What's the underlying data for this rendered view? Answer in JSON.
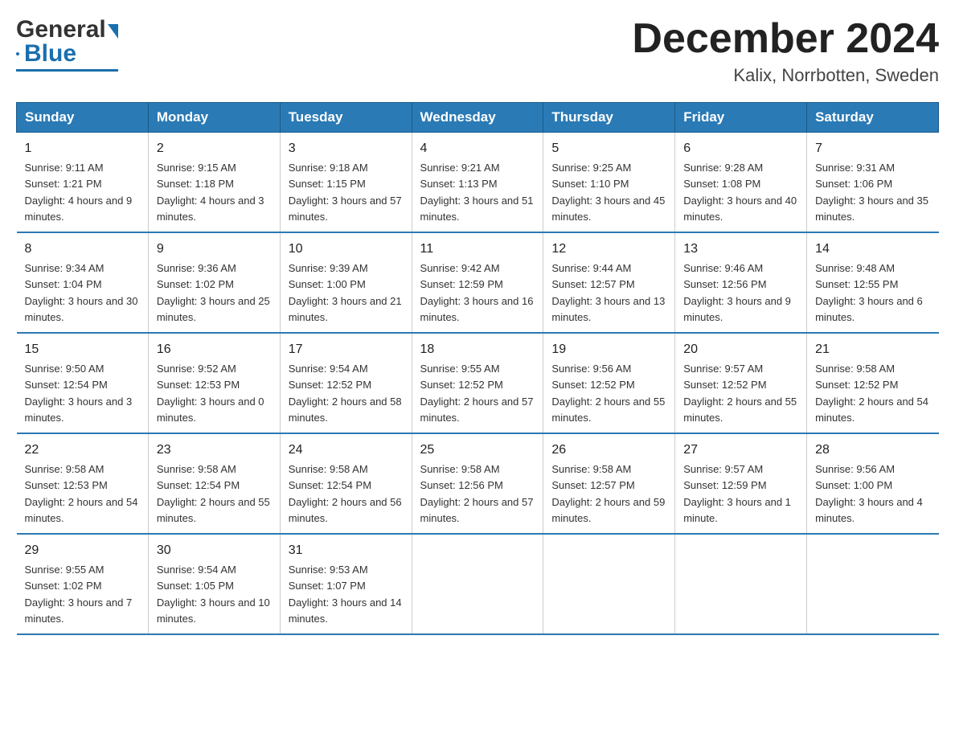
{
  "header": {
    "logo_general": "General",
    "logo_blue": "Blue",
    "month_title": "December 2024",
    "location": "Kalix, Norrbotten, Sweden"
  },
  "weekdays": [
    "Sunday",
    "Monday",
    "Tuesday",
    "Wednesday",
    "Thursday",
    "Friday",
    "Saturday"
  ],
  "weeks": [
    [
      {
        "day": "1",
        "sunrise": "Sunrise: 9:11 AM",
        "sunset": "Sunset: 1:21 PM",
        "daylight": "Daylight: 4 hours and 9 minutes."
      },
      {
        "day": "2",
        "sunrise": "Sunrise: 9:15 AM",
        "sunset": "Sunset: 1:18 PM",
        "daylight": "Daylight: 4 hours and 3 minutes."
      },
      {
        "day": "3",
        "sunrise": "Sunrise: 9:18 AM",
        "sunset": "Sunset: 1:15 PM",
        "daylight": "Daylight: 3 hours and 57 minutes."
      },
      {
        "day": "4",
        "sunrise": "Sunrise: 9:21 AM",
        "sunset": "Sunset: 1:13 PM",
        "daylight": "Daylight: 3 hours and 51 minutes."
      },
      {
        "day": "5",
        "sunrise": "Sunrise: 9:25 AM",
        "sunset": "Sunset: 1:10 PM",
        "daylight": "Daylight: 3 hours and 45 minutes."
      },
      {
        "day": "6",
        "sunrise": "Sunrise: 9:28 AM",
        "sunset": "Sunset: 1:08 PM",
        "daylight": "Daylight: 3 hours and 40 minutes."
      },
      {
        "day": "7",
        "sunrise": "Sunrise: 9:31 AM",
        "sunset": "Sunset: 1:06 PM",
        "daylight": "Daylight: 3 hours and 35 minutes."
      }
    ],
    [
      {
        "day": "8",
        "sunrise": "Sunrise: 9:34 AM",
        "sunset": "Sunset: 1:04 PM",
        "daylight": "Daylight: 3 hours and 30 minutes."
      },
      {
        "day": "9",
        "sunrise": "Sunrise: 9:36 AM",
        "sunset": "Sunset: 1:02 PM",
        "daylight": "Daylight: 3 hours and 25 minutes."
      },
      {
        "day": "10",
        "sunrise": "Sunrise: 9:39 AM",
        "sunset": "Sunset: 1:00 PM",
        "daylight": "Daylight: 3 hours and 21 minutes."
      },
      {
        "day": "11",
        "sunrise": "Sunrise: 9:42 AM",
        "sunset": "Sunset: 12:59 PM",
        "daylight": "Daylight: 3 hours and 16 minutes."
      },
      {
        "day": "12",
        "sunrise": "Sunrise: 9:44 AM",
        "sunset": "Sunset: 12:57 PM",
        "daylight": "Daylight: 3 hours and 13 minutes."
      },
      {
        "day": "13",
        "sunrise": "Sunrise: 9:46 AM",
        "sunset": "Sunset: 12:56 PM",
        "daylight": "Daylight: 3 hours and 9 minutes."
      },
      {
        "day": "14",
        "sunrise": "Sunrise: 9:48 AM",
        "sunset": "Sunset: 12:55 PM",
        "daylight": "Daylight: 3 hours and 6 minutes."
      }
    ],
    [
      {
        "day": "15",
        "sunrise": "Sunrise: 9:50 AM",
        "sunset": "Sunset: 12:54 PM",
        "daylight": "Daylight: 3 hours and 3 minutes."
      },
      {
        "day": "16",
        "sunrise": "Sunrise: 9:52 AM",
        "sunset": "Sunset: 12:53 PM",
        "daylight": "Daylight: 3 hours and 0 minutes."
      },
      {
        "day": "17",
        "sunrise": "Sunrise: 9:54 AM",
        "sunset": "Sunset: 12:52 PM",
        "daylight": "Daylight: 2 hours and 58 minutes."
      },
      {
        "day": "18",
        "sunrise": "Sunrise: 9:55 AM",
        "sunset": "Sunset: 12:52 PM",
        "daylight": "Daylight: 2 hours and 57 minutes."
      },
      {
        "day": "19",
        "sunrise": "Sunrise: 9:56 AM",
        "sunset": "Sunset: 12:52 PM",
        "daylight": "Daylight: 2 hours and 55 minutes."
      },
      {
        "day": "20",
        "sunrise": "Sunrise: 9:57 AM",
        "sunset": "Sunset: 12:52 PM",
        "daylight": "Daylight: 2 hours and 55 minutes."
      },
      {
        "day": "21",
        "sunrise": "Sunrise: 9:58 AM",
        "sunset": "Sunset: 12:52 PM",
        "daylight": "Daylight: 2 hours and 54 minutes."
      }
    ],
    [
      {
        "day": "22",
        "sunrise": "Sunrise: 9:58 AM",
        "sunset": "Sunset: 12:53 PM",
        "daylight": "Daylight: 2 hours and 54 minutes."
      },
      {
        "day": "23",
        "sunrise": "Sunrise: 9:58 AM",
        "sunset": "Sunset: 12:54 PM",
        "daylight": "Daylight: 2 hours and 55 minutes."
      },
      {
        "day": "24",
        "sunrise": "Sunrise: 9:58 AM",
        "sunset": "Sunset: 12:54 PM",
        "daylight": "Daylight: 2 hours and 56 minutes."
      },
      {
        "day": "25",
        "sunrise": "Sunrise: 9:58 AM",
        "sunset": "Sunset: 12:56 PM",
        "daylight": "Daylight: 2 hours and 57 minutes."
      },
      {
        "day": "26",
        "sunrise": "Sunrise: 9:58 AM",
        "sunset": "Sunset: 12:57 PM",
        "daylight": "Daylight: 2 hours and 59 minutes."
      },
      {
        "day": "27",
        "sunrise": "Sunrise: 9:57 AM",
        "sunset": "Sunset: 12:59 PM",
        "daylight": "Daylight: 3 hours and 1 minute."
      },
      {
        "day": "28",
        "sunrise": "Sunrise: 9:56 AM",
        "sunset": "Sunset: 1:00 PM",
        "daylight": "Daylight: 3 hours and 4 minutes."
      }
    ],
    [
      {
        "day": "29",
        "sunrise": "Sunrise: 9:55 AM",
        "sunset": "Sunset: 1:02 PM",
        "daylight": "Daylight: 3 hours and 7 minutes."
      },
      {
        "day": "30",
        "sunrise": "Sunrise: 9:54 AM",
        "sunset": "Sunset: 1:05 PM",
        "daylight": "Daylight: 3 hours and 10 minutes."
      },
      {
        "day": "31",
        "sunrise": "Sunrise: 9:53 AM",
        "sunset": "Sunset: 1:07 PM",
        "daylight": "Daylight: 3 hours and 14 minutes."
      },
      {
        "day": "",
        "sunrise": "",
        "sunset": "",
        "daylight": ""
      },
      {
        "day": "",
        "sunrise": "",
        "sunset": "",
        "daylight": ""
      },
      {
        "day": "",
        "sunrise": "",
        "sunset": "",
        "daylight": ""
      },
      {
        "day": "",
        "sunrise": "",
        "sunset": "",
        "daylight": ""
      }
    ]
  ]
}
